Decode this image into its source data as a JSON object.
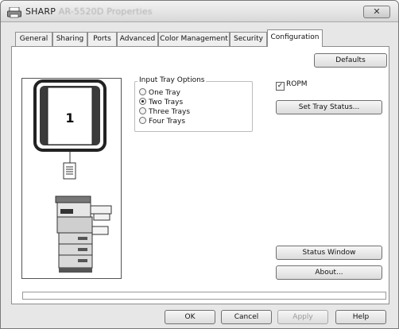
{
  "window": {
    "title_prefix": "SHARP",
    "title_model": "AR-5520D Properties",
    "close_icon": "close-icon"
  },
  "tabs": [
    {
      "label": "General"
    },
    {
      "label": "Sharing"
    },
    {
      "label": "Ports"
    },
    {
      "label": "Advanced"
    },
    {
      "label": "Color Management"
    },
    {
      "label": "Security"
    },
    {
      "label": "Configuration"
    }
  ],
  "active_tab": "Configuration",
  "config": {
    "defaults_label": "Defaults",
    "input_tray_options": {
      "legend": "Input Tray Options",
      "options": [
        {
          "label": "One Tray",
          "checked": false
        },
        {
          "label": "Two Trays",
          "checked": true
        },
        {
          "label": "Three Trays",
          "checked": false
        },
        {
          "label": "Four Trays",
          "checked": false
        }
      ]
    },
    "ropm": {
      "label": "ROPM",
      "checked": true
    },
    "set_tray_status_label": "Set Tray Status...",
    "status_window_label": "Status Window",
    "about_label": "About...",
    "preview": {
      "tray_number": "1"
    }
  },
  "footer": {
    "ok_label": "OK",
    "cancel_label": "Cancel",
    "apply_label": "Apply",
    "help_label": "Help"
  }
}
